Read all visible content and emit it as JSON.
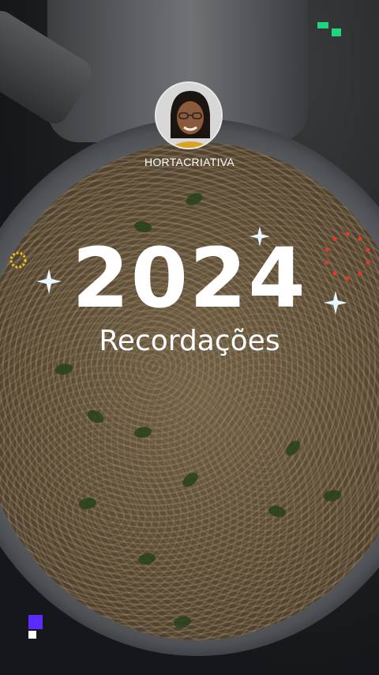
{
  "profile": {
    "username": "HORTACRIATIVA"
  },
  "recap": {
    "year": "2024",
    "subtitle": "Recordações"
  },
  "colors": {
    "text": "#ffffff",
    "sparkle": "#e8f6ff",
    "gold_ring": "#f0c419",
    "red_dots": "#e53a2b",
    "green_blocks": "#1fd67a",
    "purple_block": "#5b2cff"
  }
}
